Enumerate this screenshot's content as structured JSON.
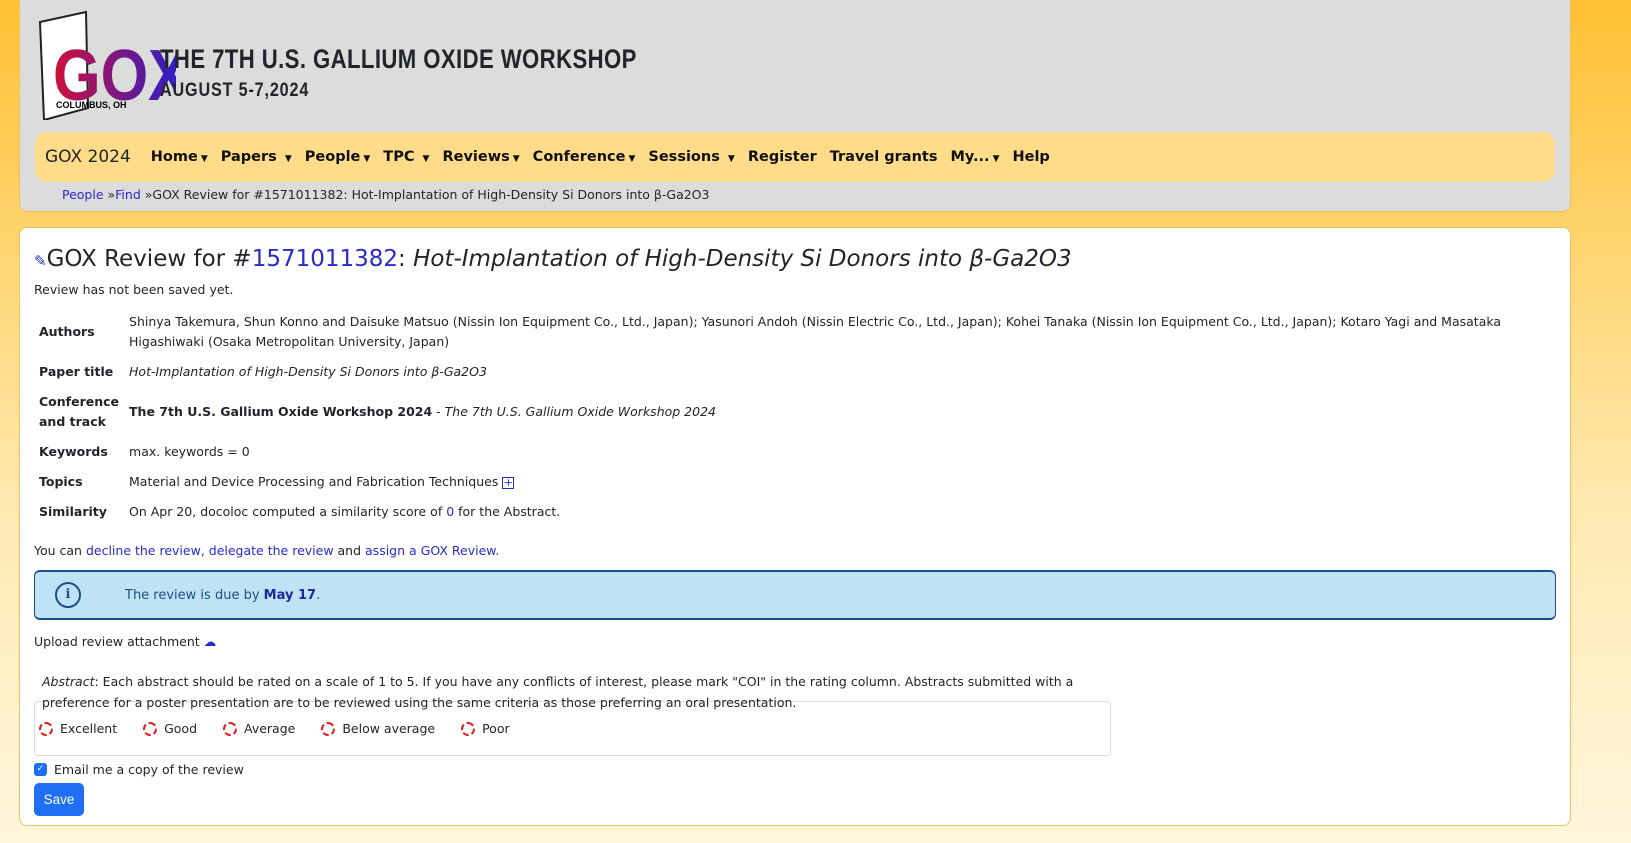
{
  "header": {
    "logo_text": "GOX",
    "logo_city": "COLUMBUS, OH",
    "title": "THE 7TH U.S. GALLIUM OXIDE WORKSHOP",
    "date": "AUGUST 5-7,2024"
  },
  "nav": {
    "brand": "GOX 2024",
    "items": [
      {
        "label": "Home",
        "dropdown": true
      },
      {
        "label": "Papers",
        "dropdown": true
      },
      {
        "label": "People",
        "dropdown": true
      },
      {
        "label": "TPC",
        "dropdown": true
      },
      {
        "label": "Reviews",
        "dropdown": true
      },
      {
        "label": "Conference",
        "dropdown": true
      },
      {
        "label": "Sessions",
        "dropdown": true
      },
      {
        "label": "Register",
        "dropdown": false
      },
      {
        "label": "Travel grants",
        "dropdown": false
      },
      {
        "label": "My...",
        "dropdown": true
      },
      {
        "label": "Help",
        "dropdown": false
      }
    ]
  },
  "breadcrumb": {
    "people": "People",
    "sep1": " »",
    "find": "Find",
    "rest": " »GOX Review for #1571011382: Hot-Implantation of High-Density Si Donors into β-Ga2O3"
  },
  "page": {
    "title_prefix": "GOX Review for #",
    "paper_id": "1571011382",
    "title_sep": ": ",
    "paper_title": "Hot-Implantation of High-Density Si Donors into β-Ga2O3",
    "status": "Review has not been saved yet.",
    "details": [
      {
        "key": "Authors",
        "value": "Shinya Takemura, Shun Konno and Daisuke Matsuo (Nissin Ion Equipment Co., Ltd., Japan); Yasunori Andoh (Nissin Electric Co., Ltd., Japan); Kohei Tanaka (Nissin Ion Equipment Co., Ltd., Japan); Kotaro Yagi and Masataka Higashiwaki (Osaka Metropolitan University, Japan)"
      },
      {
        "key": "Paper title",
        "value": "Hot-Implantation of High-Density Si Donors into β-Ga2O3"
      },
      {
        "key": "Conference and track",
        "value_bold": "The 7th U.S. Gallium Oxide Workshop 2024",
        "value_sep": " - ",
        "value_italic": "The 7th U.S. Gallium Oxide Workshop 2024"
      },
      {
        "key": "Keywords",
        "value": "max. keywords = 0"
      },
      {
        "key": "Topics",
        "value": "Material and Device Processing and Fabrication Techniques"
      },
      {
        "key": "Similarity",
        "value_pre": "On Apr 20, docoloc computed a similarity score of ",
        "value_link": "0",
        "value_post": " for the Abstract."
      }
    ],
    "actions": {
      "pre": "You can ",
      "decline": "decline the review",
      "comma": ", ",
      "delegate": "delegate the review",
      "and": " and ",
      "assign": "assign a GOX Review",
      "end": "."
    },
    "due": {
      "pre": "The review is due by ",
      "date": "May 17",
      "end": "."
    },
    "upload": "Upload review attachment",
    "abstract": {
      "label": "Abstract",
      "text": ": Each abstract should be rated on a scale of 1 to 5. If you have any conflicts of interest, please mark \"COI\" in the rating column. Abstracts submitted with a preference for a poster presentation are to be reviewed using the same criteria as those preferring an oral presentation.",
      "options": [
        "Excellent",
        "Good",
        "Average",
        "Below average",
        "Poor"
      ]
    },
    "email_copy": {
      "label": "Email me a copy of the review",
      "checked": true
    },
    "save": "Save"
  }
}
